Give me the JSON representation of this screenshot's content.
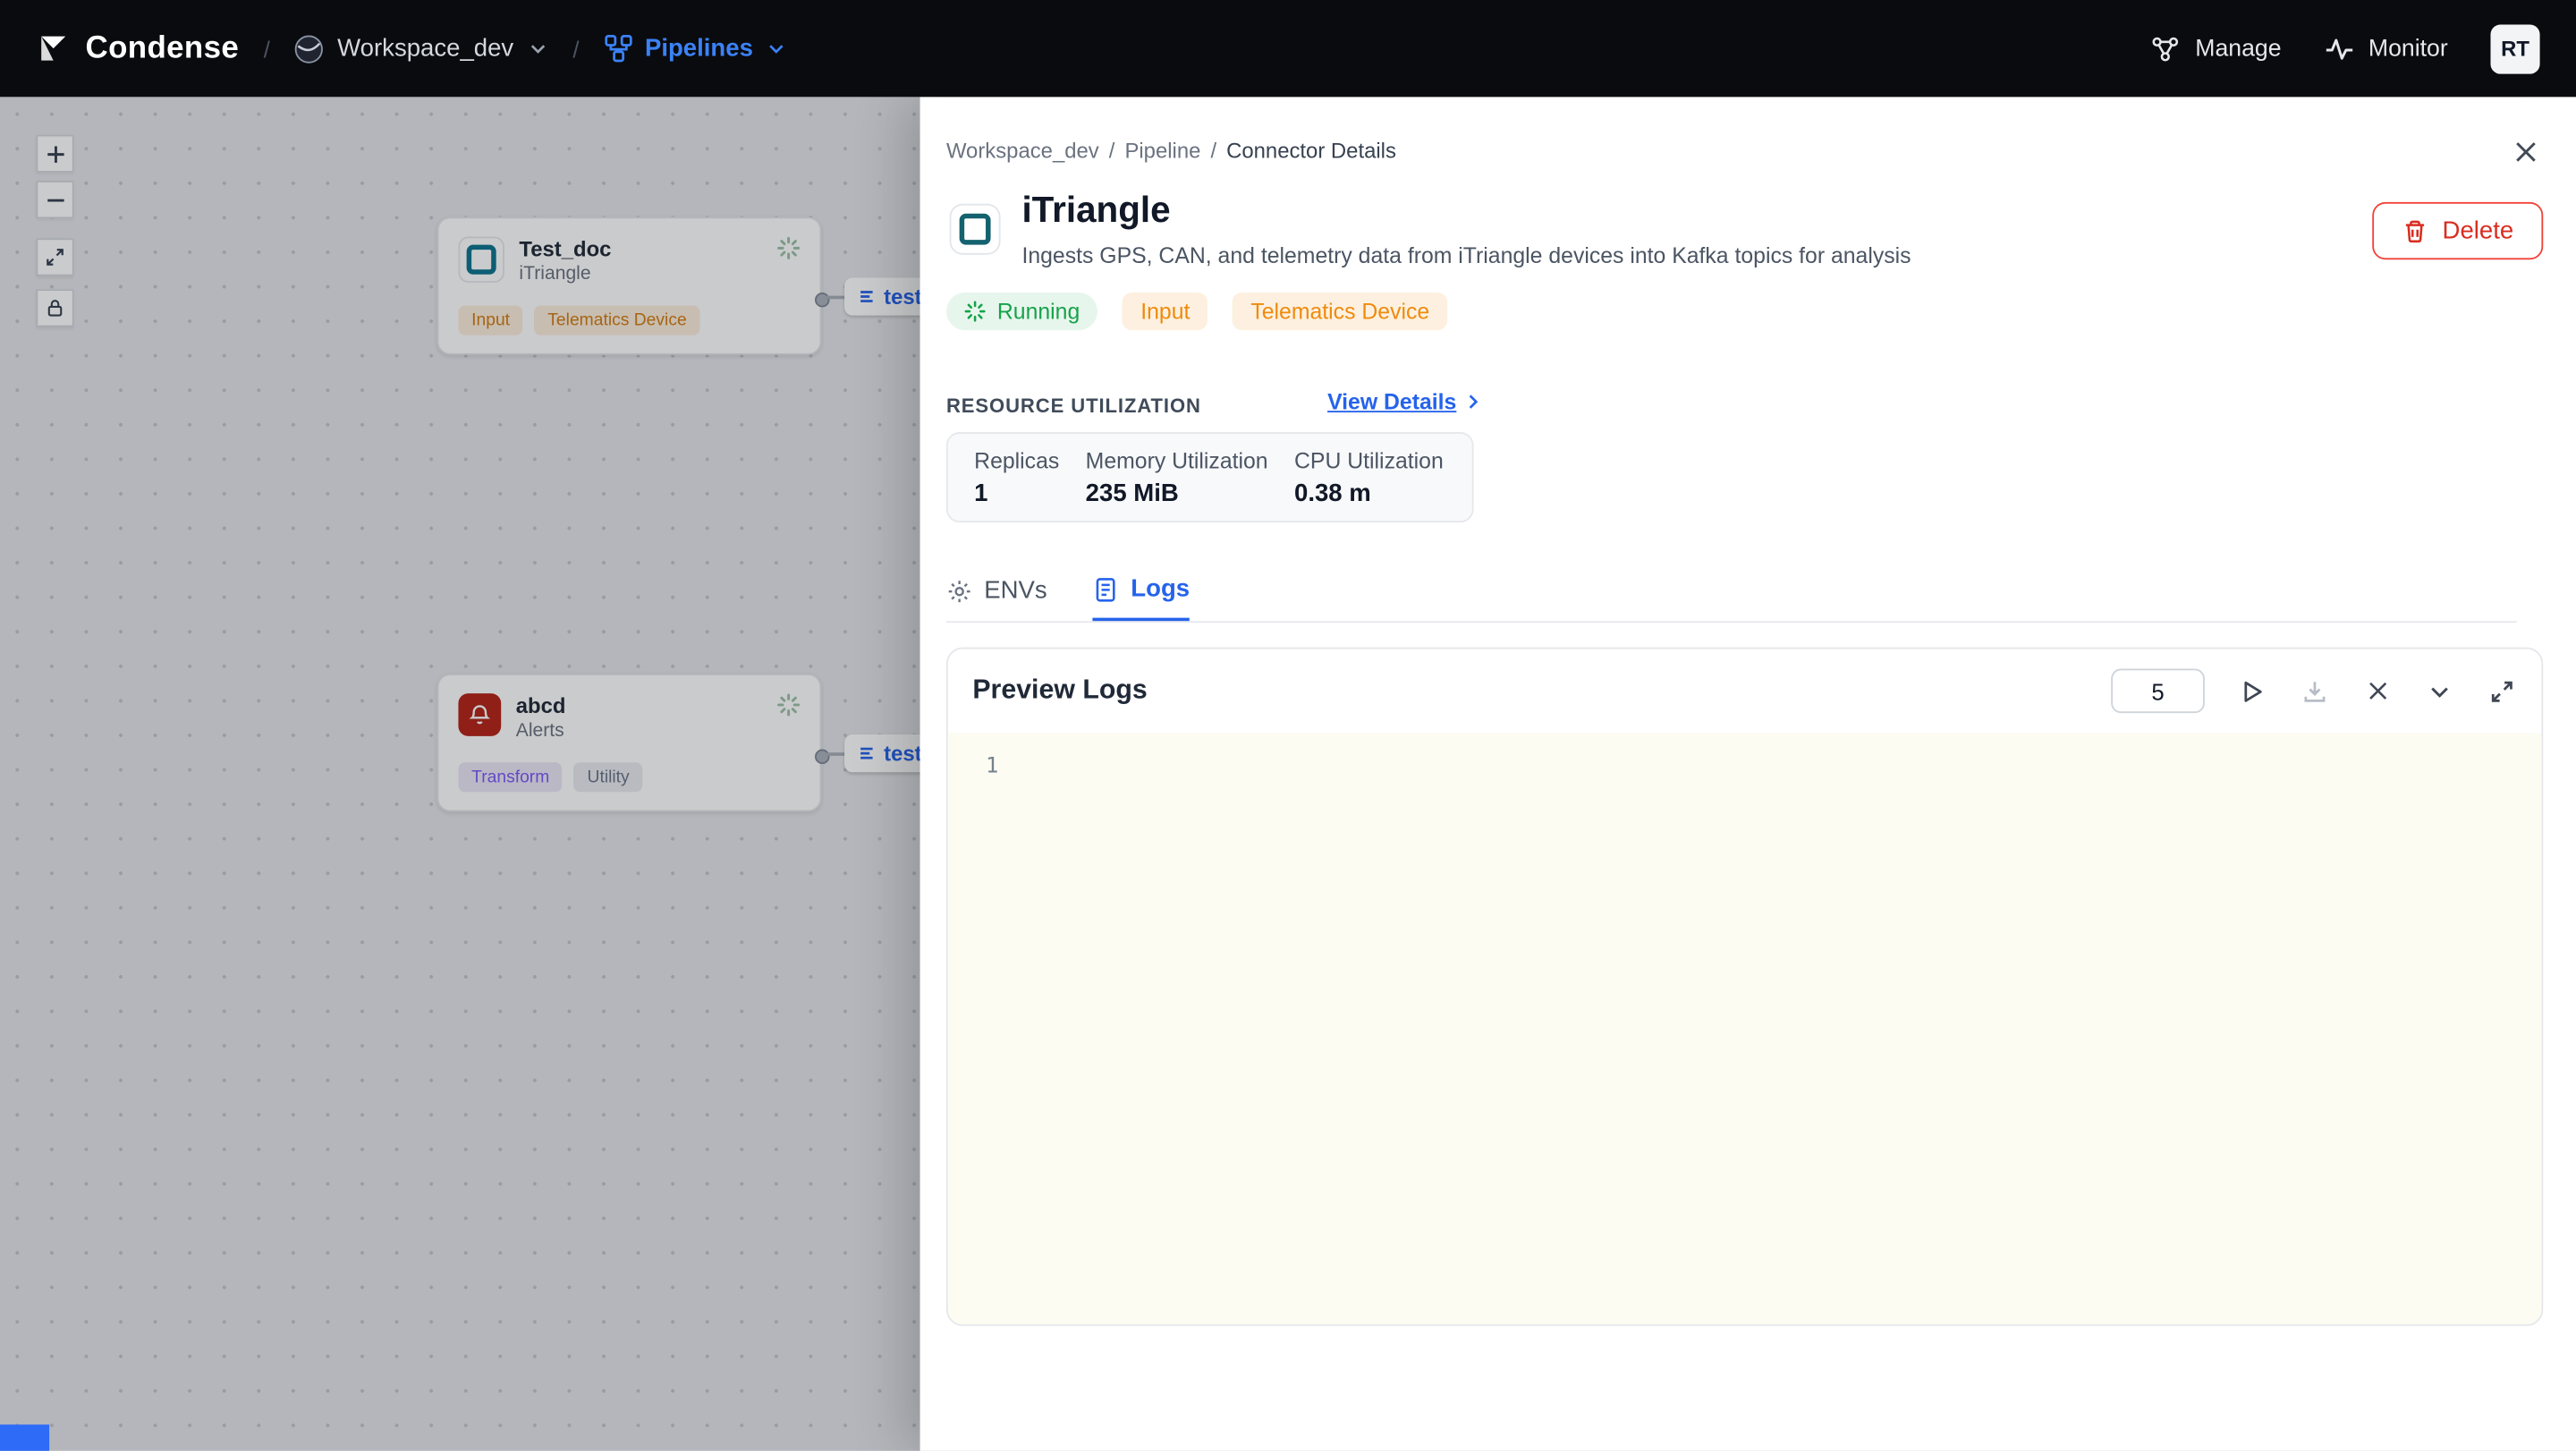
{
  "colors": {
    "accent_blue": "#2563eb",
    "status_green": "#17a24b",
    "tag_orange": "#ef8b0c",
    "danger_red": "#d92d20",
    "navbar_bg": "#0a0b0f"
  },
  "navbar": {
    "brand": "Condense",
    "separator": "/",
    "workspace": "Workspace_dev",
    "pipelines": "Pipelines",
    "manage": "Manage",
    "monitor": "Monitor",
    "avatar_initials": "RT"
  },
  "canvas": {
    "nodes": [
      {
        "title": "Test_doc",
        "subtitle": "iTriangle",
        "tags": [
          "Input",
          "Telematics Device"
        ],
        "edge_label": "test"
      },
      {
        "title": "abcd",
        "subtitle": "Alerts",
        "tags": [
          "Transform",
          "Utility"
        ],
        "edge_label": "test"
      }
    ]
  },
  "panel": {
    "breadcrumb": {
      "separator": "/",
      "items": [
        "Workspace_dev",
        "Pipeline",
        "Connector Details"
      ]
    },
    "title": "iTriangle",
    "description": "Ingests GPS, CAN, and telemetry data from iTriangle devices into Kafka topics for analysis",
    "delete_button": "Delete",
    "badges": {
      "status": "Running",
      "type": "Input",
      "category": "Telematics Device"
    },
    "resource_utilization": {
      "heading": "RESOURCE UTILIZATION",
      "view_details": "View Details",
      "metrics": [
        {
          "label": "Replicas",
          "value": "1"
        },
        {
          "label": "Memory Utilization",
          "value": "235 MiB"
        },
        {
          "label": "CPU Utilization",
          "value": "0.38 m"
        }
      ]
    },
    "tabs": {
      "envs": "ENVs",
      "logs": "Logs",
      "active": "Logs"
    },
    "logs_panel": {
      "title": "Preview Logs",
      "lines_input_value": "5",
      "line_number": "1"
    }
  }
}
